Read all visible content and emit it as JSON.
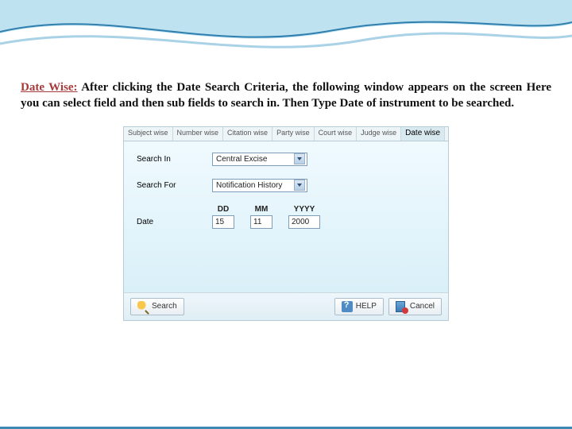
{
  "heading": {
    "lead": "Date Wise:",
    "body": " After clicking the Date Search Criteria, the following window appears on the screen Here you can select field and then sub fields to search in. Then Type Date of instrument to be searched."
  },
  "tabs": [
    "Subject wise",
    "Number wise",
    "Citation wise",
    "Party wise",
    "Court wise",
    "Judge wise",
    "Date wise"
  ],
  "form": {
    "search_in_label": "Search In",
    "search_in_value": "Central Excise",
    "search_for_label": "Search For",
    "search_for_value": "Notification History",
    "date_label": "Date",
    "hdr_dd": "DD",
    "hdr_mm": "MM",
    "hdr_yyyy": "YYYY",
    "dd": "15",
    "mm": "11",
    "yyyy": "2000"
  },
  "buttons": {
    "search": "Search",
    "help": "HELP",
    "cancel": "Cancel"
  }
}
